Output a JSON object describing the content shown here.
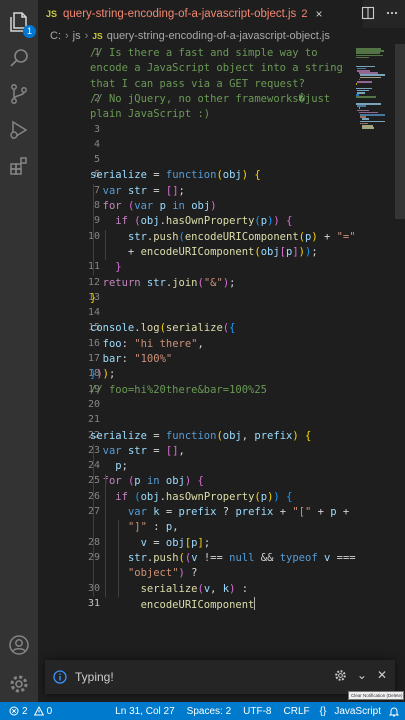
{
  "activity_bar": {
    "items": [
      "explorer-icon",
      "search-icon",
      "source-control-icon",
      "run-debug-icon",
      "extensions-icon"
    ],
    "bottom": [
      "account-icon",
      "manage-gear-icon"
    ],
    "explorer_badge": "1"
  },
  "tab": {
    "js_label": "JS",
    "filename": "query-string-encoding-of-a-javascript-object.js",
    "problem_count": "2",
    "close_glyph": "×"
  },
  "breadcrumb": {
    "drive": "C:",
    "folder": "js",
    "js_label": "JS",
    "file": "query-string-encoding-of-a-javascript-object.js"
  },
  "editor": {
    "lines": [
      {
        "n": "1",
        "tokens": [
          [
            "cm",
            "// Is there a fast and simple way to"
          ]
        ]
      },
      {
        "n": "",
        "tokens": [
          [
            "cm",
            "encode a JavaScript object into a string"
          ]
        ]
      },
      {
        "n": "",
        "tokens": [
          [
            "cm",
            "that I can pass via a GET request?"
          ]
        ]
      },
      {
        "n": "2",
        "tokens": [
          [
            "cm",
            "// No jQuery, no other frameworks�just"
          ]
        ]
      },
      {
        "n": "",
        "tokens": [
          [
            "cm",
            "plain JavaScript :)"
          ]
        ]
      },
      {
        "n": "3",
        "tokens": []
      },
      {
        "n": "4",
        "tokens": []
      },
      {
        "n": "5",
        "tokens": []
      },
      {
        "n": "6",
        "tokens": [
          [
            "var",
            "serialize"
          ],
          [
            "op",
            " = "
          ],
          [
            "kw",
            "function"
          ],
          [
            "br1",
            "("
          ],
          [
            "var",
            "obj"
          ],
          [
            "br1",
            ")"
          ],
          [
            "op",
            " "
          ],
          [
            "br1",
            "{"
          ]
        ]
      },
      {
        "n": "7",
        "tokens": [
          [
            "op",
            "  "
          ],
          [
            "kw",
            "var"
          ],
          [
            "op",
            " "
          ],
          [
            "var",
            "str"
          ],
          [
            "op",
            " = "
          ],
          [
            "br2",
            "[]"
          ],
          [
            "op",
            ";"
          ]
        ]
      },
      {
        "n": "8",
        "tokens": [
          [
            "op",
            "  "
          ],
          [
            "ctl",
            "for"
          ],
          [
            "op",
            " "
          ],
          [
            "br2",
            "("
          ],
          [
            "kw",
            "var"
          ],
          [
            "op",
            " "
          ],
          [
            "var",
            "p"
          ],
          [
            "op",
            " "
          ],
          [
            "kw",
            "in"
          ],
          [
            "op",
            " "
          ],
          [
            "var",
            "obj"
          ],
          [
            "br2",
            ")"
          ]
        ]
      },
      {
        "n": "9",
        "tokens": [
          [
            "op",
            "    "
          ],
          [
            "ctl",
            "if"
          ],
          [
            "op",
            " "
          ],
          [
            "br2",
            "("
          ],
          [
            "var",
            "obj"
          ],
          [
            "op",
            "."
          ],
          [
            "fn",
            "hasOwnProperty"
          ],
          [
            "br3",
            "("
          ],
          [
            "var",
            "p"
          ],
          [
            "br3",
            ")"
          ],
          [
            "br2",
            ")"
          ],
          [
            "op",
            " "
          ],
          [
            "br2",
            "{"
          ]
        ]
      },
      {
        "n": "10",
        "tokens": [
          [
            "op",
            "      "
          ],
          [
            "var",
            "str"
          ],
          [
            "op",
            "."
          ],
          [
            "fn",
            "push"
          ],
          [
            "br3",
            "("
          ],
          [
            "fn",
            "encodeURIComponent"
          ],
          [
            "br1",
            "("
          ],
          [
            "var",
            "p"
          ],
          [
            "br1",
            ")"
          ],
          [
            "op",
            " + "
          ],
          [
            "str",
            "\"=\""
          ]
        ]
      },
      {
        "n": "",
        "tokens": [
          [
            "op",
            "      + "
          ],
          [
            "fn",
            "encodeURIComponent"
          ],
          [
            "br1",
            "("
          ],
          [
            "var",
            "obj"
          ],
          [
            "br2",
            "["
          ],
          [
            "var",
            "p"
          ],
          [
            "br2",
            "]"
          ],
          [
            "br1",
            ")"
          ],
          [
            "br3",
            ")"
          ],
          [
            "op",
            ";"
          ]
        ]
      },
      {
        "n": "11",
        "tokens": [
          [
            "op",
            "    "
          ],
          [
            "br2",
            "}"
          ]
        ]
      },
      {
        "n": "12",
        "tokens": [
          [
            "op",
            "  "
          ],
          [
            "ctl",
            "return"
          ],
          [
            "op",
            " "
          ],
          [
            "var",
            "str"
          ],
          [
            "op",
            "."
          ],
          [
            "fn",
            "join"
          ],
          [
            "br2",
            "("
          ],
          [
            "str",
            "\"&\""
          ],
          [
            "br2",
            ")"
          ],
          [
            "op",
            ";"
          ]
        ]
      },
      {
        "n": "13",
        "tokens": [
          [
            "br1",
            "}"
          ]
        ]
      },
      {
        "n": "14",
        "tokens": []
      },
      {
        "n": "15",
        "tokens": [
          [
            "var",
            "console"
          ],
          [
            "op",
            "."
          ],
          [
            "fn",
            "log"
          ],
          [
            "br1",
            "("
          ],
          [
            "fn",
            "serialize"
          ],
          [
            "br2",
            "("
          ],
          [
            "br3",
            "{"
          ]
        ]
      },
      {
        "n": "16",
        "tokens": [
          [
            "op",
            "  "
          ],
          [
            "var",
            "foo"
          ],
          [
            "op",
            ": "
          ],
          [
            "str",
            "\"hi there\""
          ],
          [
            "op",
            ","
          ]
        ]
      },
      {
        "n": "17",
        "tokens": [
          [
            "op",
            "  "
          ],
          [
            "var",
            "bar"
          ],
          [
            "op",
            ": "
          ],
          [
            "str",
            "\"100%\""
          ]
        ]
      },
      {
        "n": "18",
        "tokens": [
          [
            "br3",
            "}"
          ],
          [
            "br2",
            ")"
          ],
          [
            "br1",
            ")"
          ],
          [
            "op",
            ";"
          ]
        ]
      },
      {
        "n": "19",
        "tokens": [
          [
            "cm",
            "// foo=hi%20there&bar=100%25"
          ]
        ]
      },
      {
        "n": "20",
        "tokens": []
      },
      {
        "n": "21",
        "tokens": []
      },
      {
        "n": "22",
        "tokens": [
          [
            "var",
            "serialize"
          ],
          [
            "op",
            " = "
          ],
          [
            "kw",
            "function"
          ],
          [
            "br1",
            "("
          ],
          [
            "var",
            "obj"
          ],
          [
            "op",
            ", "
          ],
          [
            "var",
            "prefix"
          ],
          [
            "br1",
            ")"
          ],
          [
            "op",
            " "
          ],
          [
            "br1",
            "{"
          ]
        ]
      },
      {
        "n": "23",
        "tokens": [
          [
            "op",
            "  "
          ],
          [
            "kw",
            "var"
          ],
          [
            "op",
            " "
          ],
          [
            "var",
            "str"
          ],
          [
            "op",
            " = "
          ],
          [
            "br2",
            "[]"
          ],
          [
            "op",
            ","
          ]
        ]
      },
      {
        "n": "24",
        "tokens": [
          [
            "op",
            "    "
          ],
          [
            "var",
            "p"
          ],
          [
            "op",
            ";"
          ]
        ]
      },
      {
        "n": "25",
        "tokens": [
          [
            "op",
            "  "
          ],
          [
            "ctl",
            "for"
          ],
          [
            "op",
            " "
          ],
          [
            "br2",
            "("
          ],
          [
            "var",
            "p"
          ],
          [
            "op",
            " "
          ],
          [
            "kw",
            "in"
          ],
          [
            "op",
            " "
          ],
          [
            "var",
            "obj"
          ],
          [
            "br2",
            ")"
          ],
          [
            "op",
            " "
          ],
          [
            "br2",
            "{"
          ]
        ]
      },
      {
        "n": "26",
        "tokens": [
          [
            "op",
            "    "
          ],
          [
            "ctl",
            "if"
          ],
          [
            "op",
            " "
          ],
          [
            "br3",
            "("
          ],
          [
            "var",
            "obj"
          ],
          [
            "op",
            "."
          ],
          [
            "fn",
            "hasOwnProperty"
          ],
          [
            "br1",
            "("
          ],
          [
            "var",
            "p"
          ],
          [
            "br1",
            ")"
          ],
          [
            "br3",
            ")"
          ],
          [
            "op",
            " "
          ],
          [
            "br3",
            "{"
          ]
        ]
      },
      {
        "n": "27",
        "tokens": [
          [
            "op",
            "      "
          ],
          [
            "kw",
            "var"
          ],
          [
            "op",
            " "
          ],
          [
            "var",
            "k"
          ],
          [
            "op",
            " = "
          ],
          [
            "var",
            "prefix"
          ],
          [
            "op",
            " ? "
          ],
          [
            "var",
            "prefix"
          ],
          [
            "op",
            " + "
          ],
          [
            "str",
            "\"[\""
          ],
          [
            "op",
            " + "
          ],
          [
            "var",
            "p"
          ],
          [
            "op",
            " +"
          ]
        ]
      },
      {
        "n": "",
        "tokens": [
          [
            "op",
            "      "
          ],
          [
            "str",
            "\"]\""
          ],
          [
            "op",
            " : "
          ],
          [
            "var",
            "p"
          ],
          [
            "op",
            ","
          ]
        ]
      },
      {
        "n": "28",
        "tokens": [
          [
            "op",
            "        "
          ],
          [
            "var",
            "v"
          ],
          [
            "op",
            " = "
          ],
          [
            "var",
            "obj"
          ],
          [
            "br1",
            "["
          ],
          [
            "var",
            "p"
          ],
          [
            "br1",
            "]"
          ],
          [
            "op",
            ";"
          ]
        ]
      },
      {
        "n": "29",
        "tokens": [
          [
            "op",
            "      "
          ],
          [
            "var",
            "str"
          ],
          [
            "op",
            "."
          ],
          [
            "fn",
            "push"
          ],
          [
            "br1",
            "("
          ],
          [
            "br2",
            "("
          ],
          [
            "var",
            "v"
          ],
          [
            "op",
            " !== "
          ],
          [
            "kw",
            "null"
          ],
          [
            "op",
            " && "
          ],
          [
            "kw",
            "typeof"
          ],
          [
            "op",
            " "
          ],
          [
            "var",
            "v"
          ],
          [
            "op",
            " ==="
          ]
        ]
      },
      {
        "n": "",
        "tokens": [
          [
            "op",
            "      "
          ],
          [
            "str",
            "\"object\""
          ],
          [
            "br2",
            ")"
          ],
          [
            "op",
            " ?"
          ]
        ]
      },
      {
        "n": "30",
        "tokens": [
          [
            "op",
            "        "
          ],
          [
            "fn",
            "serialize"
          ],
          [
            "br2",
            "("
          ],
          [
            "var",
            "v"
          ],
          [
            "op",
            ", "
          ],
          [
            "var",
            "k"
          ],
          [
            "br2",
            ")"
          ],
          [
            "op",
            " :"
          ]
        ]
      },
      {
        "n": "31",
        "tokens": [
          [
            "op",
            "        "
          ],
          [
            "fn",
            "encodeURIComponent"
          ]
        ]
      }
    ],
    "active_line": "31"
  },
  "notification": {
    "text": "Typing!",
    "tooltip": "Clear Notification (Delete)"
  },
  "status_bar": {
    "errors": "2",
    "warnings": "0",
    "position": "Ln 31, Col 27",
    "spaces": "Spaces: 2",
    "encoding": "UTF-8",
    "eol": "CRLF",
    "braces": "{}",
    "language": "JavaScript"
  },
  "colors": {
    "accent": "#007acc",
    "editor_bg": "#1e1e1e",
    "activity_bg": "#333333",
    "error_text": "#f48771"
  }
}
